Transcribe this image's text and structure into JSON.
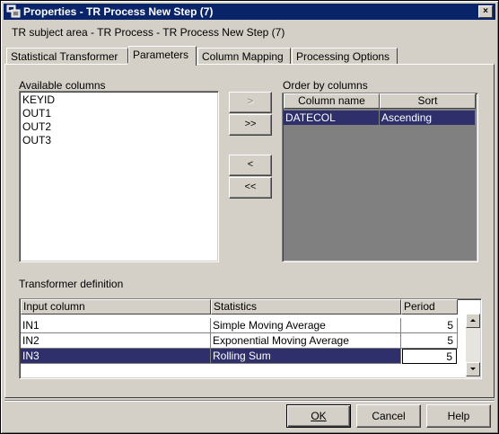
{
  "window": {
    "title": "Properties - TR Process New Step (7)",
    "close_glyph": "×"
  },
  "subject": "TR subject area - TR Process - TR Process New Step (7)",
  "tabs": [
    {
      "label": "Statistical Transformer",
      "active": false
    },
    {
      "label": "Parameters",
      "active": true
    },
    {
      "label": "Column Mapping",
      "active": false
    },
    {
      "label": "Processing Options",
      "active": false
    }
  ],
  "available_columns": {
    "label": "Available columns",
    "items": [
      "KEYID",
      "OUT1",
      "OUT2",
      "OUT3"
    ]
  },
  "move_buttons": {
    "add_one": ">",
    "add_all": ">>",
    "remove_one": "<",
    "remove_all": "<<"
  },
  "order_by": {
    "label": "Order by columns",
    "headers": [
      "Column name",
      "Sort"
    ],
    "rows": [
      {
        "column": "DATECOL",
        "sort": "Ascending",
        "selected": true
      }
    ]
  },
  "transformer": {
    "label": "Transformer definition",
    "headers": [
      "Input column",
      "Statistics",
      "Period"
    ],
    "rows": [
      {
        "input": "IN1",
        "statistic": "Simple Moving Average",
        "period": "5",
        "selected": false
      },
      {
        "input": "IN2",
        "statistic": "Exponential Moving Average",
        "period": "5",
        "selected": false
      },
      {
        "input": "IN3",
        "statistic": "Rolling Sum",
        "period": "5",
        "selected": true
      }
    ]
  },
  "buttons": {
    "ok": "OK",
    "cancel": "Cancel",
    "help": "Help"
  },
  "colors": {
    "titlebar": "#0a246a",
    "selection": "#2e2f6b",
    "face": "#d4d0c8"
  }
}
